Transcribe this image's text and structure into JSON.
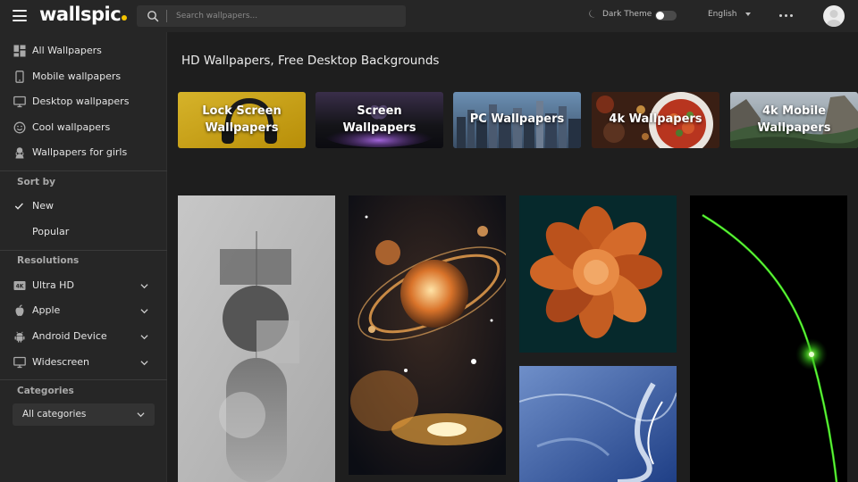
{
  "header": {
    "logo_text": "wallspic",
    "search_placeholder": "Search wallpapers...",
    "dark_theme_label": "Dark Theme",
    "language": "English"
  },
  "sidebar": {
    "nav": [
      {
        "label": "All Wallpapers",
        "icon": "grid-icon"
      },
      {
        "label": "Mobile wallpapers",
        "icon": "phone-icon"
      },
      {
        "label": "Desktop wallpapers",
        "icon": "monitor-icon"
      },
      {
        "label": "Cool wallpapers",
        "icon": "smile-icon"
      },
      {
        "label": "Wallpapers for girls",
        "icon": "girl-icon"
      }
    ],
    "sort_title": "Sort by",
    "sort_options": [
      {
        "label": "New",
        "selected": true
      },
      {
        "label": "Popular",
        "selected": false
      }
    ],
    "resolutions_title": "Resolutions",
    "resolutions": [
      {
        "label": "Ultra HD",
        "icon": "4k-icon"
      },
      {
        "label": "Apple",
        "icon": "apple-icon"
      },
      {
        "label": "Android Device",
        "icon": "android-icon"
      },
      {
        "label": "Widescreen",
        "icon": "monitor-icon"
      }
    ],
    "categories_title": "Categories",
    "categories_select": "All categories"
  },
  "main": {
    "title": "HD Wallpapers, Free Desktop Backgrounds",
    "category_cards": [
      {
        "label": "Lock Screen Wallpapers"
      },
      {
        "label": "Screen Wallpapers"
      },
      {
        "label": "PC Wallpapers"
      },
      {
        "label": "4k Wallpapers"
      },
      {
        "label": "4k Mobile Wallpapers"
      }
    ]
  },
  "colors": {
    "accent": "#f5c400",
    "background": "#1e1e1e",
    "panel": "#262626"
  }
}
